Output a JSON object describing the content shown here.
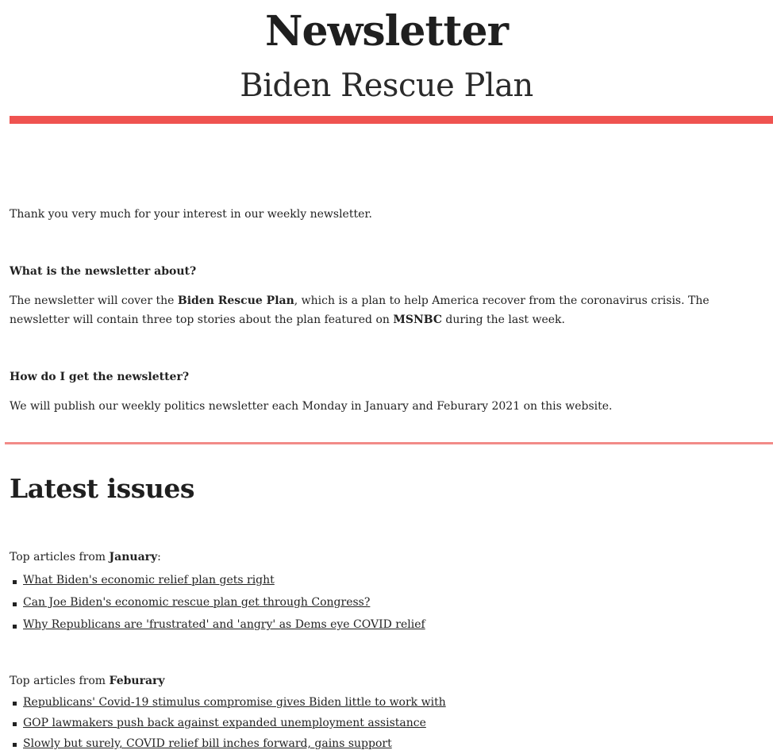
{
  "header": {
    "title": "Newsletter",
    "subtitle": "Biden Rescue Plan"
  },
  "intro": {
    "text": "Thank you very much for your interest in our weekly newsletter."
  },
  "faq": [
    {
      "question": "What is the newsletter about?",
      "answer_parts": [
        "The newsletter will cover the ",
        "Biden Rescue Plan",
        ", which is a plan to help America recover from the coronavirus crisis. The newsletter will contain three top stories about the plan featured on ",
        "MSNBC",
        " during the last week."
      ]
    },
    {
      "question": "How do I get the newsletter?",
      "answer": "We will publish our weekly politics newsletter each Monday in January and Feburary 2021 on this website."
    }
  ],
  "latest": {
    "heading": "Latest issues",
    "months": [
      {
        "prefix": "Top articles from ",
        "month": "January",
        "suffix": ":",
        "articles": [
          "What Biden's economic relief plan gets right",
          "Can Joe Biden's economic rescue plan get through Congress?",
          "Why Republicans are 'frustrated' and 'angry' as Dems eye COVID relief"
        ]
      },
      {
        "prefix": "Top articles from ",
        "month": "Feburary",
        "suffix": "",
        "articles": [
          "Republicans' Covid-19 stimulus compromise gives Biden little to work with",
          "GOP lawmakers push back against expanded unemployment assistance",
          "Slowly but surely, COVID relief bill inches forward, gains support"
        ]
      }
    ]
  },
  "colors": {
    "accent_bar": "#ef5350",
    "divider": "#f28b88",
    "text": "#222222"
  }
}
